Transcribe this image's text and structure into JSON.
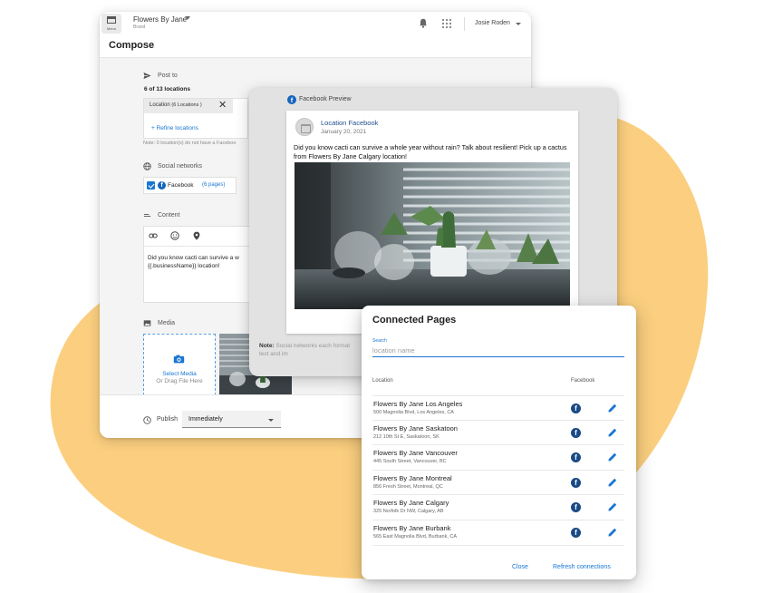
{
  "colors": {
    "accent": "#1976d2",
    "blob": "#fbcf7f",
    "facebook": "#1565c0"
  },
  "topbar": {
    "menu_label": "Menu",
    "brand_name": "Flowers By Jane",
    "brand_sub": "Brand",
    "user_name": "Josie Roden",
    "icons": [
      "bell-icon",
      "apps-grid-icon"
    ]
  },
  "compose": {
    "title": "Compose",
    "post_to": {
      "label": "Post to",
      "count": "6 of 13 locations",
      "chip_label": "Location",
      "chip_count": "(6 Locations )",
      "refine": "+ Refine locations",
      "note": "Note: 0 location(s) do not have a Faceboo"
    },
    "social": {
      "label": "Social networks",
      "network": "Facebook",
      "pages": "(6 pages)"
    },
    "content": {
      "label": "Content",
      "line1": "Did you know cacti can survive a w",
      "line2": "{{.businessName}} location!"
    },
    "media": {
      "label": "Media",
      "select": "Select Media",
      "drag": "Or Drag File Here"
    },
    "publish": {
      "label": "Publish",
      "value": "Immediately"
    }
  },
  "preview": {
    "title": "Facebook Preview",
    "post": {
      "name": "Location Facebook",
      "date": "January 20, 2021",
      "text": "Did you know cacti can survive a whole year without rain? Talk about resilient! Pick up a cactus from Flowers By Jane Calgary location!"
    },
    "note_label": "Note:",
    "note_text": "Social networks each format text and im"
  },
  "dialog": {
    "title": "Connected Pages",
    "search_label": "Search",
    "search_placeholder": "location name",
    "col_location": "Location",
    "col_facebook": "Facebook",
    "rows": [
      {
        "name": "Flowers By Jane Los Angeles",
        "address": "500 Magnolia Blvd, Los Angeles, CA"
      },
      {
        "name": "Flowers By Jane Saskatoon",
        "address": "212 10th St E, Saskatoon, SK"
      },
      {
        "name": "Flowers By Jane Vancouver",
        "address": "445 South Street, Vancouver, BC"
      },
      {
        "name": "Flowers By Jane Montreal",
        "address": "856 Fresh Street, Montreal, QC"
      },
      {
        "name": "Flowers By Jane Calgary",
        "address": "325 Norfolk Dr NW, Calgary, AB"
      },
      {
        "name": "Flowers By Jane Burbank",
        "address": "565 East Magnolia Blvd, Burbank, CA"
      }
    ],
    "close": "Close",
    "refresh": "Refresh connections"
  }
}
